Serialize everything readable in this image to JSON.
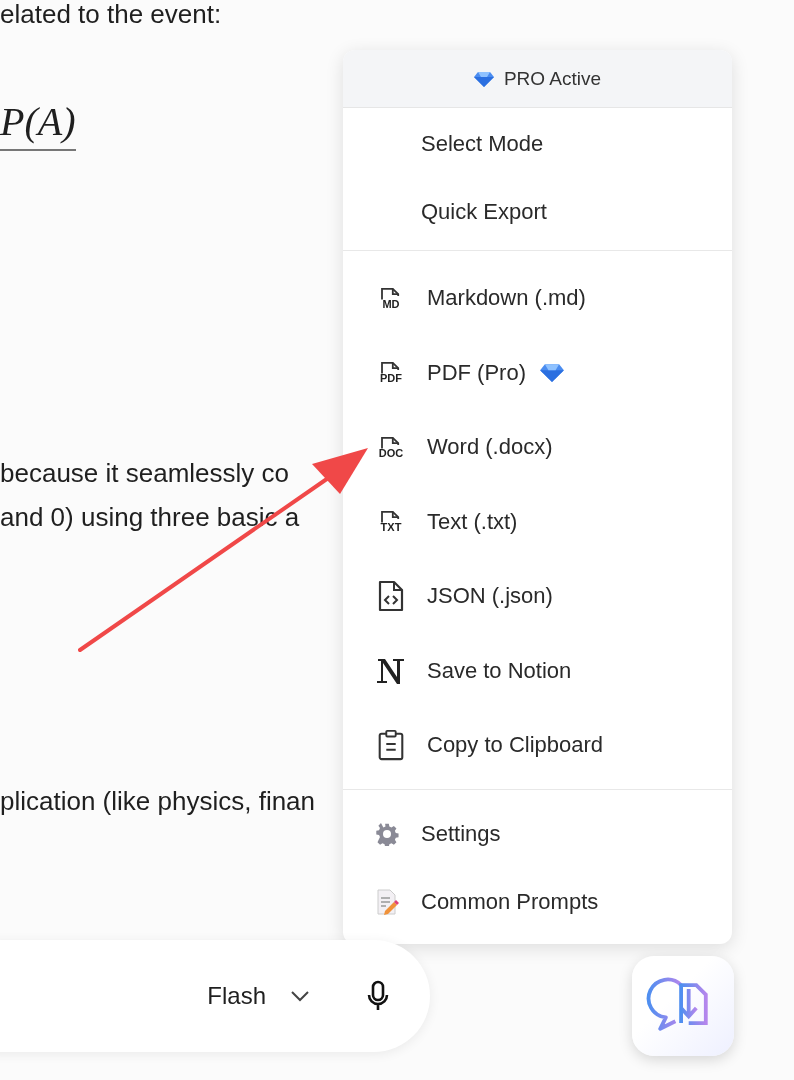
{
  "document": {
    "lines": [
      {
        "kind": "text",
        "text": "elated to the event:"
      },
      {
        "kind": "math",
        "text": "P(A)"
      },
      {
        "kind": "text",
        "text": "because it seamlessly co"
      },
      {
        "kind": "text",
        "text": "and 0) using three basic a"
      },
      {
        "kind": "text",
        "text": "plication (like physics, finan"
      }
    ]
  },
  "export_menu": {
    "header": {
      "label": "PRO Active"
    },
    "sections": [
      [
        {
          "kind": "plain",
          "label": "Select Mode"
        },
        {
          "kind": "plain",
          "label": "Quick Export"
        }
      ],
      [
        {
          "kind": "file",
          "tag": "MD",
          "label": "Markdown (.md)"
        },
        {
          "kind": "file",
          "tag": "PDF",
          "label": "PDF (Pro)",
          "pro": true
        },
        {
          "kind": "file",
          "tag": "DOC",
          "label": "Word (.docx)"
        },
        {
          "kind": "file",
          "tag": "TXT",
          "label": "Text (.txt)"
        },
        {
          "kind": "code",
          "label": "JSON (.json)"
        },
        {
          "kind": "notion",
          "label": "Save to Notion"
        },
        {
          "kind": "clipboard",
          "label": "Copy to Clipboard"
        }
      ],
      [
        {
          "kind": "gear",
          "label": "Settings"
        },
        {
          "kind": "note",
          "label": "Common Prompts"
        }
      ]
    ]
  },
  "chat_bar": {
    "model": "Flash"
  }
}
